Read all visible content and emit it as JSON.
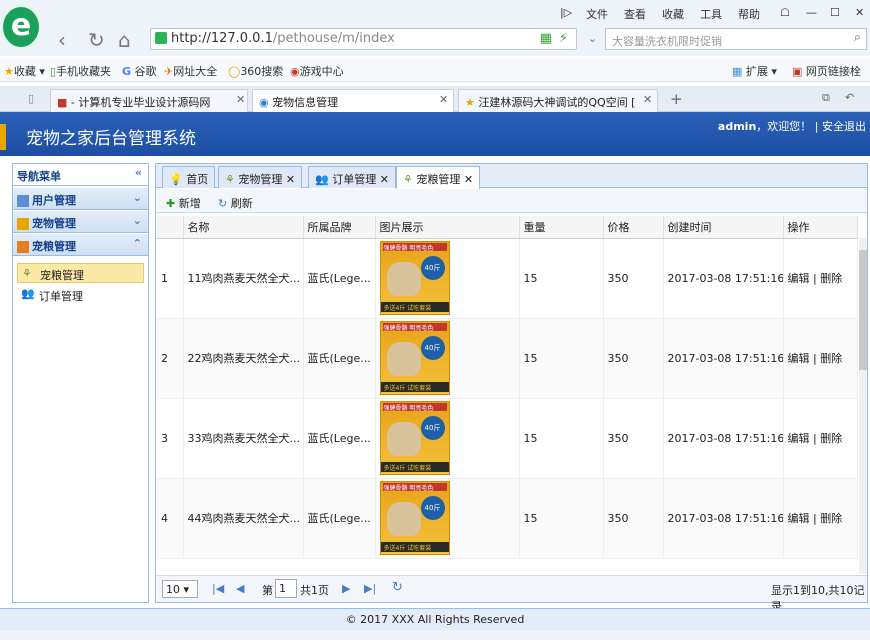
{
  "browser": {
    "menu": [
      "文件",
      "查看",
      "收藏",
      "工具",
      "帮助"
    ],
    "url_host": "http://127.0.0.1",
    "url_path": "/pethouse/m/index",
    "search_placeholder": "大容量洗衣机限时促销",
    "favorites": [
      "收藏",
      "手机收藏夹",
      "谷歌",
      "网址大全",
      "360搜索",
      "游戏中心"
    ],
    "fav_right": [
      "扩展",
      "网页链接栓"
    ],
    "tabs": [
      {
        "label": "- 计算机专业毕业设计源码网",
        "active": false
      },
      {
        "label": "宠物信息管理",
        "active": true
      },
      {
        "label": "汪建林源码大神调试的QQ空间 [",
        "active": false
      }
    ]
  },
  "app": {
    "title": "宠物之家后台管理系统",
    "user": "admin",
    "welcome": "，欢迎您！",
    "logout": "安全退出"
  },
  "sidebar": {
    "header": "导航菜单",
    "groups": [
      {
        "label": "用户管理"
      },
      {
        "label": "宠物管理"
      },
      {
        "label": "宠粮管理"
      }
    ],
    "items": [
      {
        "label": "宠粮管理"
      },
      {
        "label": "订单管理"
      }
    ]
  },
  "content_tabs": [
    "首页",
    "宠物管理",
    "订单管理",
    "宠粮管理"
  ],
  "toolbar": {
    "add": "新增",
    "refresh": "刷新"
  },
  "table": {
    "headers": [
      "名称",
      "所属品牌",
      "图片展示",
      "重量",
      "价格",
      "创建时间",
      "操作"
    ],
    "image_banner": "强健骨骼 明亮毛色",
    "image_badge": "40斤",
    "image_footer": "多送4斤 试吃套装",
    "rows": [
      {
        "num": "1",
        "name": "11鸡肉燕麦天然全犬...",
        "brand": "蓝氏(Lege...",
        "weight": "15",
        "price": "350",
        "created": "2017-03-08 17:51:16"
      },
      {
        "num": "2",
        "name": "22鸡肉燕麦天然全犬...",
        "brand": "蓝氏(Lege...",
        "weight": "15",
        "price": "350",
        "created": "2017-03-08 17:51:16"
      },
      {
        "num": "3",
        "name": "33鸡肉燕麦天然全犬...",
        "brand": "蓝氏(Lege...",
        "weight": "15",
        "price": "350",
        "created": "2017-03-08 17:51:16"
      },
      {
        "num": "4",
        "name": "44鸡肉燕麦天然全犬...",
        "brand": "蓝氏(Lege...",
        "weight": "15",
        "price": "350",
        "created": "2017-03-08 17:51:16"
      }
    ],
    "edit": "编辑",
    "sep": "|",
    "delete": "删除"
  },
  "pager": {
    "page_size": "10",
    "page_prefix": "第",
    "page_value": "1",
    "page_suffix": "共1页",
    "summary": "显示1到10,共10记录"
  },
  "footer": "© 2017 XXX All Rights Reserved",
  "colors": {
    "header_blue": "#2158b0",
    "panel_border": "#99bbe8",
    "active_item": "#fbe9a8"
  }
}
